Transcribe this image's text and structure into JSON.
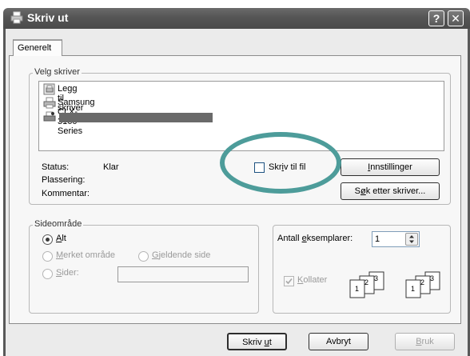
{
  "window": {
    "title": "Skriv ut",
    "help_label": "?",
    "close_label": "✕",
    "app_icon": "printer-icon"
  },
  "tabs": [
    {
      "label": "Generelt",
      "selected": true
    }
  ],
  "printer_section": {
    "legend": "Velg skriver",
    "printers": [
      {
        "label": "Legg til skriver",
        "icon": "add-printer-icon"
      },
      {
        "label": "Samsung CLX-3160 Series",
        "icon": "printer-icon"
      },
      {
        "label": "",
        "icon": "printer-icon",
        "redacted": true
      }
    ],
    "status_label": "Status:",
    "status_value": "Klar",
    "location_label": "Plassering:",
    "comment_label": "Kommentar:",
    "print_to_file": {
      "label_pre": "Skr",
      "label_u": "i",
      "label_post": "v til fil",
      "checked": false
    },
    "settings_button": {
      "pre": "",
      "u": "I",
      "post": "nnstillinger"
    },
    "find_button": {
      "pre": "S",
      "u": "ø",
      "post": "k etter skriver..."
    }
  },
  "page_range": {
    "legend": "Sideområde",
    "all": {
      "u": "A",
      "post": "lt",
      "selected": true
    },
    "selection": {
      "u": "M",
      "post": "erket område",
      "enabled": false
    },
    "current": {
      "u": "G",
      "post": "jeldende side",
      "enabled": false
    },
    "pages": {
      "u": "S",
      "post": "ider:",
      "enabled": false,
      "value": ""
    }
  },
  "copies": {
    "label_pre": "Antall ",
    "label_u": "e",
    "label_post": "ksemplarer:",
    "value": "1",
    "collate": {
      "u": "K",
      "post": "ollater",
      "checked": true,
      "enabled": false
    }
  },
  "buttons": {
    "print": {
      "pre": "Skriv ",
      "u": "u",
      "post": "t"
    },
    "cancel": {
      "label": "Avbryt"
    },
    "apply": {
      "u": "B",
      "post": "ruk",
      "enabled": false
    }
  },
  "colors": {
    "accent_ring": "#4d9c9a",
    "titlebar": "#555555"
  }
}
